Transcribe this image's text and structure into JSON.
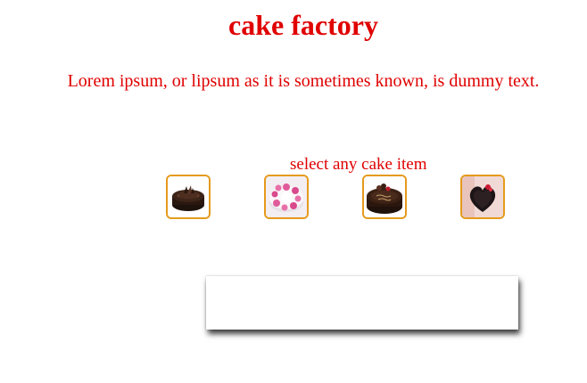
{
  "header": {
    "title": "cake factory"
  },
  "intro": {
    "text": "Lorem ipsum, or lipsum as it is sometimes known, is dummy text."
  },
  "selector": {
    "prompt": "select any cake item",
    "items": [
      {
        "icon": "chocolate-cake-icon"
      },
      {
        "icon": "pink-cream-cake-icon"
      },
      {
        "icon": "birthday-cake-icon"
      },
      {
        "icon": "heart-cake-icon"
      }
    ]
  },
  "colors": {
    "text": "#e00000",
    "thumb_border": "#e59a1c",
    "background": "#ffffff"
  }
}
